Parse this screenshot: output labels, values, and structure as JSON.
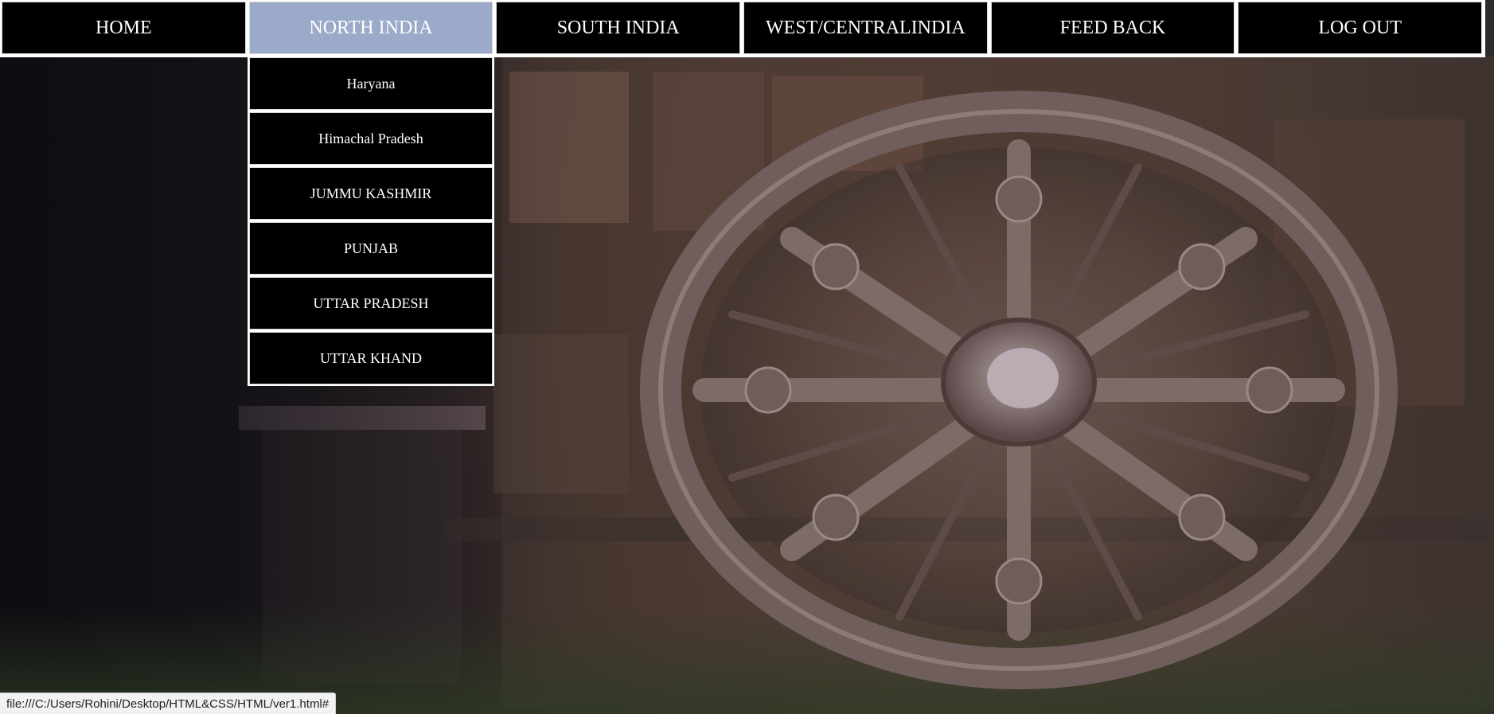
{
  "nav": {
    "items": [
      {
        "label": "HOME"
      },
      {
        "label": "NORTH INDIA"
      },
      {
        "label": "SOUTH INDIA"
      },
      {
        "label": "WEST/CENTRALINDIA"
      },
      {
        "label": "FEED BACK"
      },
      {
        "label": "LOG OUT"
      }
    ],
    "active_color": "#9aaac8",
    "item_color": "#000000",
    "text_color": "#ffffff"
  },
  "dropdown": {
    "items": [
      {
        "label": "Haryana"
      },
      {
        "label": "Himachal Pradesh"
      },
      {
        "label": "JUMMU KASHMIR"
      },
      {
        "label": "PUNJAB"
      },
      {
        "label": "UTTAR PRADESH"
      },
      {
        "label": "UTTAR KHAND"
      }
    ]
  },
  "statusbar": {
    "url": "file:///C:/Users/Rohini/Desktop/HTML&CSS/HTML/ver1.html#"
  },
  "background": {
    "subject": "stone chariot wheel carving"
  }
}
